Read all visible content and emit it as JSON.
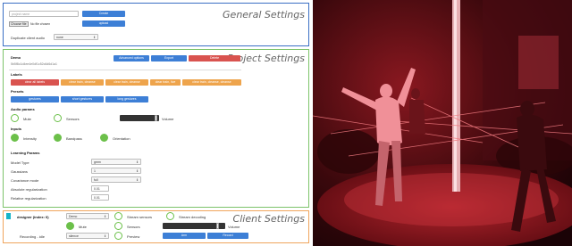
{
  "general": {
    "title": "General Settings",
    "project_name_placeholder": "project name",
    "create_label": "Create",
    "choose_file_label": "Choose file",
    "no_file_label": "No file chosen",
    "upload_label": "upload",
    "duplicate_label": "Duplicate client audio",
    "duplicate_value": "none"
  },
  "project": {
    "title": "Project Settings",
    "name": "Demo",
    "id": "5b5f8c1d4ee4e0df1c52c6d6d1a1",
    "buttons": {
      "advanced": "Advanced options",
      "export": "Export",
      "delete": "Delete"
    },
    "labels_heading": "Labels",
    "labels": [
      "clear all labels",
      "clear train, cleanse",
      "clear train, cleanse",
      "clear train, live",
      "clear train, cleanse, cleanse"
    ],
    "presets_heading": "Presets",
    "presets": [
      "gestures",
      "short gestures",
      "long gestures"
    ],
    "audio_heading": "Audio params",
    "mute_label": "Mute",
    "sensors_label": "Sensors",
    "volume_label": "Volume",
    "volume_level": 0.95,
    "inputs_heading": "Inputs",
    "inputs": [
      "Intensity",
      "Bandpass",
      "Orientation"
    ],
    "learning_heading": "Learning Params",
    "params": [
      {
        "label": "Model Type",
        "value": "gmm"
      },
      {
        "label": "Gaussians",
        "value": "1"
      },
      {
        "label": "Covariance mode",
        "value": "full"
      },
      {
        "label": "Absolute regularization",
        "value": "0.01"
      },
      {
        "label": "Relative regularization",
        "value": "0.01"
      }
    ]
  },
  "client": {
    "title": "Client Settings",
    "designer_label": "designer (index: 0)",
    "project_value": "Demo",
    "stream_sensors_label": "Stream sensors",
    "stream_decoding_label": "Stream decoding",
    "mute_label": "Mute",
    "sensors_label": "Sensors",
    "volume_label": "Volume",
    "volume_level": 0.9,
    "recording_label": "Recording - idle",
    "recording_value": "silence",
    "preview_label": "Preview",
    "arm_label": "Arm",
    "record_label": "Record"
  },
  "photo": {
    "icon": "performance-photo",
    "colors": {
      "red_dark": "#2a0608",
      "red_mid": "#a01a22",
      "red_bright": "#e8545a",
      "stage": "#7a0e16"
    }
  }
}
